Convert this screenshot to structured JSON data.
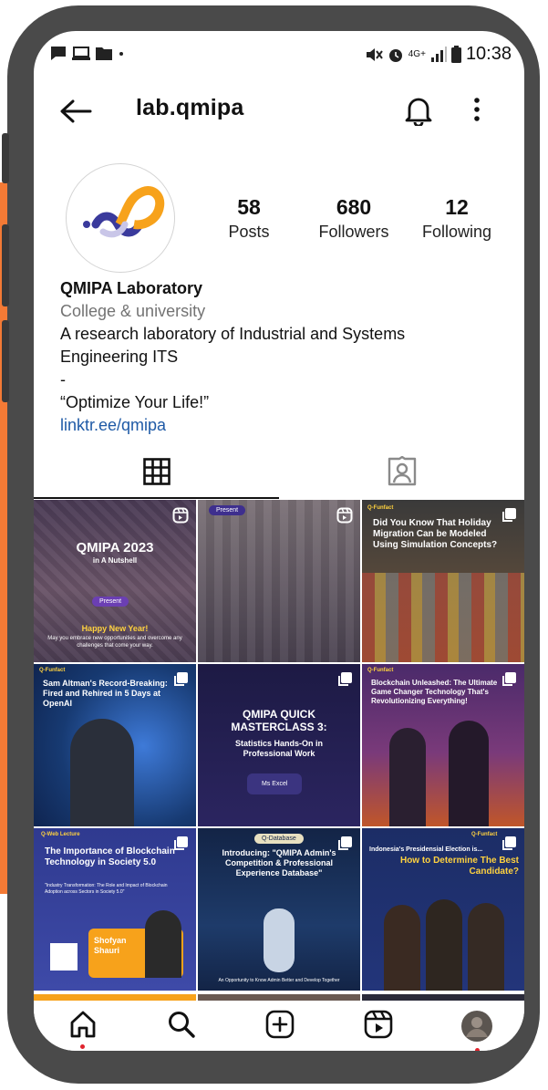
{
  "status_bar": {
    "time": "10:38",
    "network": "4G+",
    "left_icons": [
      "message-icon",
      "cast-icon",
      "folder-icon",
      "dot-icon"
    ],
    "right_icons": [
      "mute-icon",
      "alarm-icon",
      "signal-icon",
      "battery-icon"
    ]
  },
  "header": {
    "username": "lab.qmipa"
  },
  "profile": {
    "stats": {
      "posts": {
        "value": "58",
        "label": "Posts"
      },
      "followers": {
        "value": "680",
        "label": "Followers"
      },
      "following": {
        "value": "12",
        "label": "Following"
      }
    },
    "name": "QMIPA Laboratory",
    "category": "College & university",
    "bio_lines": [
      "A research laboratory of Industrial and Systems",
      "Engineering ITS",
      "-",
      "“Optimize Your Life!”"
    ],
    "link": "linktr.ee/qmipa"
  },
  "tabs": [
    {
      "name": "grid",
      "icon": "grid-icon",
      "active": true
    },
    {
      "name": "tagged",
      "icon": "tagged-person-icon",
      "active": false
    }
  ],
  "posts": [
    {
      "title": "QMIPA 2023",
      "subtitle": "in A Nutshell",
      "chip": "Present",
      "greeting": "Happy New Year!",
      "footer": "May you embrace new opportunities and overcome any challenges that come your way.",
      "badge": "reel-icon",
      "bg": "#5a4a5e"
    },
    {
      "chip": "Present",
      "badge": "reel-icon",
      "bg": "#6e6470"
    },
    {
      "tag": "Q-Funfact",
      "title": "Did You Know That Holiday Migration Can be Modeled Using Simulation Concepts?",
      "badge": "multi-post-icon",
      "bg": "#3d3a36"
    },
    {
      "tag": "Q-Funfact",
      "title": "Sam Altman's Record-Breaking: Fired and Rehired in 5 Days at OpenAI",
      "badge": "multi-post-icon",
      "bg": "#1d3f74"
    },
    {
      "title": "QMIPA QUICK MASTERCLASS 3:",
      "subtitle": "Statistics Hands-On in Professional Work",
      "chip": "Ms Excel",
      "badge": "multi-post-icon",
      "bg": "#221f4d"
    },
    {
      "tag": "Q-Funfact",
      "title": "Blockchain Unleashed: The Ultimate Game Changer Technology That's Revolutionizing Everything!",
      "badge": "multi-post-icon",
      "bg": "#5a2e6e"
    },
    {
      "tag": "Q-Web Lecture",
      "title": "The Importance of Blockchain Technology in Society 5.0",
      "subtitle": "\"Industry Transformation: The Role and Impact of Blockchain Adoption across Sectors in Society 5.0\"",
      "speaker": "Shofyan Shauri",
      "badge": "multi-post-icon",
      "bg": "#2f3a8f"
    },
    {
      "tag": "Q-Database",
      "title": "Introducing: \"QMIPA Admin's Competition & Professional Experience Database\"",
      "footer": "An Opportunity to Know Admin Better and Develop Together",
      "badge": "multi-post-icon",
      "bg": "#132446"
    },
    {
      "tag": "Q-Funfact",
      "title": "Indonesia's Presidensial Election is...",
      "subtitle": "How to Determine The Best Candidate?",
      "badge": "multi-post-icon",
      "bg": "#1c2d66"
    }
  ],
  "bottom_nav": [
    {
      "name": "home",
      "icon": "home-icon"
    },
    {
      "name": "search",
      "icon": "search-icon"
    },
    {
      "name": "create",
      "icon": "add-post-icon"
    },
    {
      "name": "reels",
      "icon": "reels-icon"
    },
    {
      "name": "profile",
      "icon": "profile-avatar-icon"
    }
  ],
  "colors": {
    "link": "#1f5aa6",
    "category_text": "#737373",
    "notification_dot": "#e0242d",
    "logo_orange": "#f7a21b",
    "logo_blue": "#3a3a9c",
    "accent_orange": "#f47a35"
  }
}
